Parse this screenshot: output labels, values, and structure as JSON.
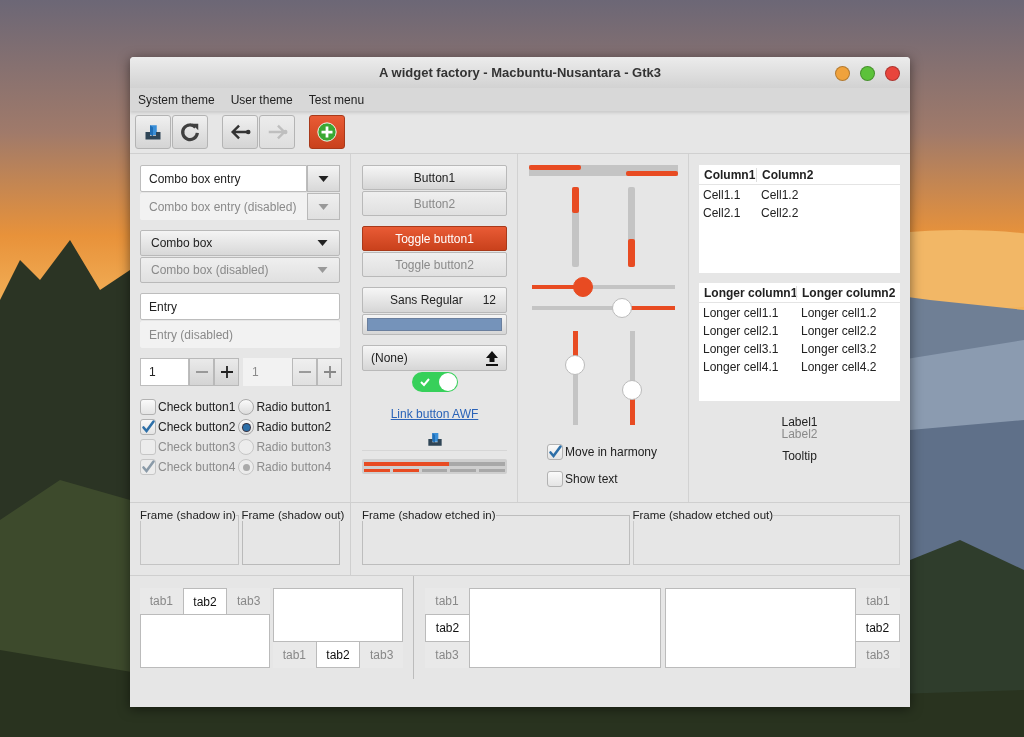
{
  "window": {
    "title": "A widget factory - Macbuntu-Nusantara - Gtk3"
  },
  "menu": [
    "System theme",
    "User theme",
    "Test menu"
  ],
  "toolbar": [
    {
      "kind": "open",
      "disabled": false,
      "active": false
    },
    {
      "kind": "refresh",
      "disabled": false,
      "active": false
    },
    {
      "kind": "back",
      "disabled": false,
      "active": false
    },
    {
      "kind": "forward",
      "disabled": true,
      "active": false
    },
    {
      "kind": "add",
      "disabled": false,
      "active": true
    }
  ],
  "combo_entries": [
    {
      "value": "Combo box entry",
      "disabled": false
    },
    {
      "value": "Combo box entry (disabled)",
      "disabled": true
    }
  ],
  "combo_boxes": [
    {
      "value": "Combo box",
      "disabled": false
    },
    {
      "value": "Combo box (disabled)",
      "disabled": true
    }
  ],
  "entries": [
    {
      "value": "Entry",
      "disabled": false
    },
    {
      "value": "Entry (disabled)",
      "disabled": true
    }
  ],
  "spin_buttons": [
    {
      "value": "1",
      "disabled": false
    },
    {
      "value": "1",
      "disabled": true
    }
  ],
  "check_buttons": [
    {
      "label": "Check button1",
      "checked": false,
      "disabled": false
    },
    {
      "label": "Check button2",
      "checked": true,
      "disabled": false
    },
    {
      "label": "Check button3",
      "checked": false,
      "disabled": true
    },
    {
      "label": "Check button4",
      "checked": true,
      "disabled": true
    }
  ],
  "radio_buttons": [
    {
      "label": "Radio button1",
      "selected": false,
      "disabled": false
    },
    {
      "label": "Radio button2",
      "selected": true,
      "disabled": false
    },
    {
      "label": "Radio button3",
      "selected": false,
      "disabled": true
    },
    {
      "label": "Radio button4",
      "selected": true,
      "disabled": true
    }
  ],
  "buttons": [
    {
      "label": "Button1",
      "disabled": false
    },
    {
      "label": "Button2",
      "disabled": true
    }
  ],
  "toggle_buttons": [
    {
      "label": "Toggle button1",
      "on": true,
      "disabled": false
    },
    {
      "label": "Toggle button2",
      "on": false,
      "disabled": true
    }
  ],
  "font_button": {
    "family": "Sans Regular",
    "size": "12"
  },
  "color_button": {
    "color": "#7593ba"
  },
  "file_button": {
    "label": "(None)"
  },
  "switch": {
    "on": true
  },
  "link_button": {
    "label": "Link button AWF"
  },
  "progress_bars": [
    {
      "kind": "continuous",
      "level": 0.6
    },
    {
      "kind": "discrete",
      "level": 0.4
    }
  ],
  "horizontal_progress": [
    {
      "level": 0.35,
      "inverted": false
    },
    {
      "level": 0.35,
      "inverted": true
    }
  ],
  "vertical_progress": [
    {
      "level": 0.33,
      "inverted": false
    },
    {
      "level": 0.35,
      "inverted": true
    }
  ],
  "horizontal_scales": [
    {
      "level": 0.36,
      "inverted": false,
      "focused": true
    },
    {
      "level": 0.37,
      "inverted": true,
      "focused": false
    }
  ],
  "vertical_scales": [
    {
      "level": 0.36,
      "inverted": false,
      "focused": false
    },
    {
      "level": 0.37,
      "inverted": true,
      "focused": false
    }
  ],
  "scale_options": [
    {
      "label": "Move in harmony",
      "checked": true
    },
    {
      "label": "Show text",
      "checked": false
    }
  ],
  "tree_views": [
    {
      "columns": [
        "Column1",
        "Column2"
      ],
      "rows": [
        [
          "Cell1.1",
          "Cell1.2"
        ],
        [
          "Cell2.1",
          "Cell2.2"
        ]
      ]
    },
    {
      "columns": [
        "Longer column1",
        "Longer column2"
      ],
      "rows": [
        [
          "Longer cell1.1",
          "Longer cell1.2"
        ],
        [
          "Longer cell2.1",
          "Longer cell2.2"
        ],
        [
          "Longer cell3.1",
          "Longer cell3.2"
        ],
        [
          "Longer cell4.1",
          "Longer cell4.2"
        ]
      ]
    }
  ],
  "labels": [
    {
      "text": "Label1",
      "disabled": false
    },
    {
      "text": "Label2",
      "disabled": true
    }
  ],
  "tooltip": "Tooltip",
  "frames": [
    {
      "label": "Frame (shadow in)",
      "kind": "in"
    },
    {
      "label": "Frame (shadow out)",
      "kind": "out"
    },
    {
      "label": "Frame (shadow etched in)",
      "kind": "etched_in"
    },
    {
      "label": "Frame (shadow etched out)",
      "kind": "etched_out"
    }
  ],
  "notebooks": [
    {
      "kind": "top",
      "tabs": [
        {
          "label": "tab1",
          "selected": false
        },
        {
          "label": "tab2",
          "selected": true
        },
        {
          "label": "tab3",
          "selected": false
        }
      ]
    },
    {
      "kind": "bottom",
      "tabs": [
        {
          "label": "tab1",
          "selected": false
        },
        {
          "label": "tab2",
          "selected": true
        },
        {
          "label": "tab3",
          "selected": false
        }
      ]
    },
    {
      "kind": "left",
      "tabs": [
        {
          "label": "tab1",
          "selected": false
        },
        {
          "label": "tab2",
          "selected": true
        },
        {
          "label": "tab3",
          "selected": false
        }
      ]
    },
    {
      "kind": "right",
      "tabs": [
        {
          "label": "tab1",
          "selected": false
        },
        {
          "label": "tab2",
          "selected": true
        },
        {
          "label": "tab3",
          "selected": false
        }
      ]
    }
  ]
}
